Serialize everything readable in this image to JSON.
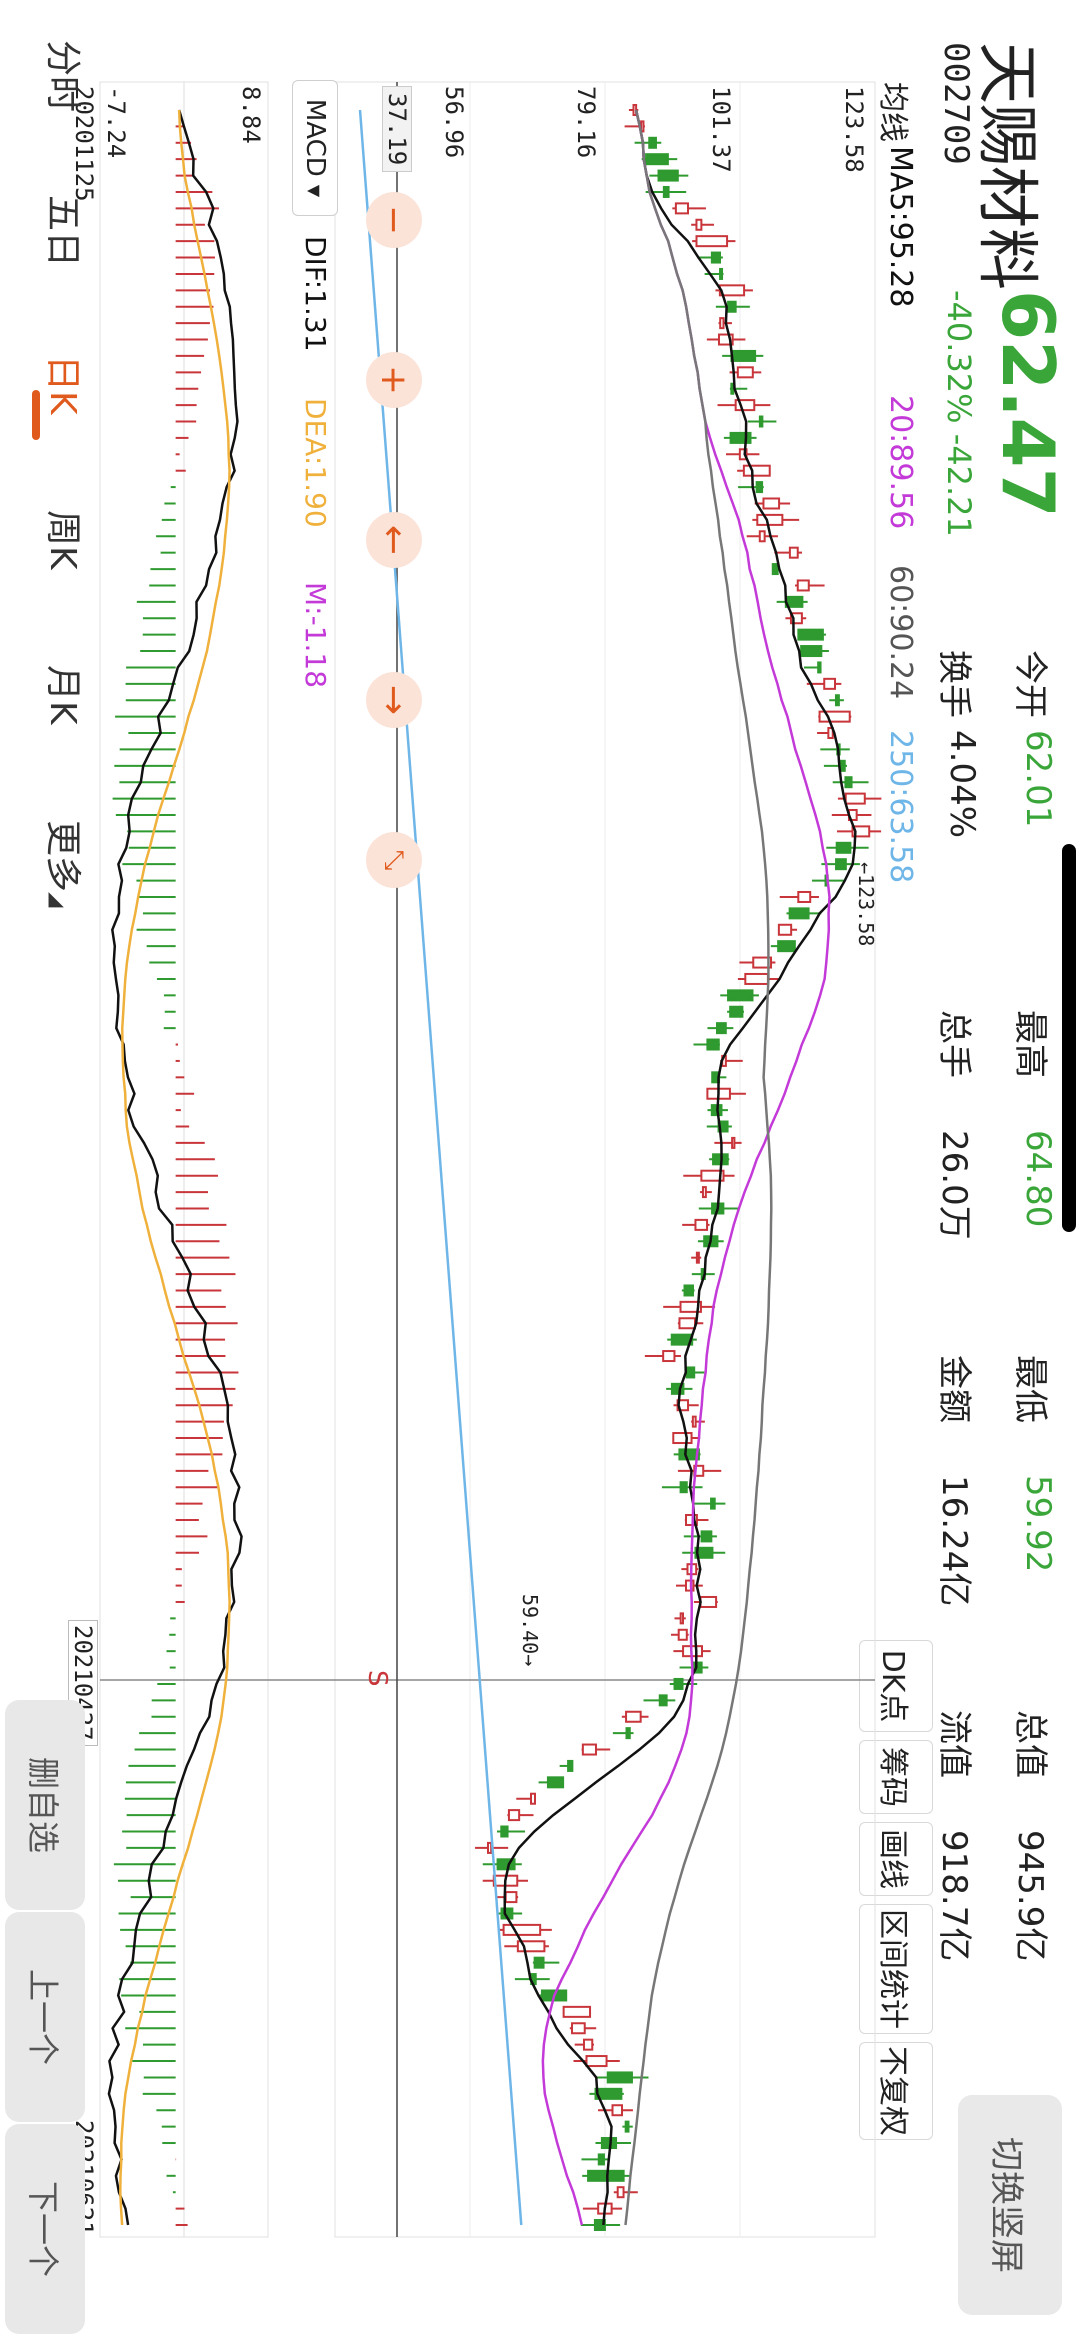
{
  "stock": {
    "name": "天赐材料",
    "code": "002709",
    "price": "62.47",
    "change_pct": "-40.32%",
    "change_amt": "-42.21"
  },
  "stats": {
    "open_label": "今开",
    "open": "62.01",
    "high_label": "最高",
    "high": "64.80",
    "low_label": "最低",
    "low": "59.92",
    "cap_label": "总值",
    "cap": "945.9亿",
    "turnover_label": "换手",
    "turnover": "4.04%",
    "volume_label": "总手",
    "volume": "26.0万",
    "amount_label": "金额",
    "amount": "16.24亿",
    "float_label": "流值",
    "float_cap": "918.7亿"
  },
  "header_button": "切换竖屏",
  "toolbar": [
    "DK点",
    "筹码",
    "画线",
    "区间统计",
    "不复权"
  ],
  "ma_line": {
    "label": "均线",
    "ma5": "MA5:95.28",
    "ma20": "20:89.56",
    "ma60": "60:90.24",
    "ma250": "250:63.58"
  },
  "main_chart": {
    "y_top": "123.58",
    "y_mid1": "101.37",
    "y_mid2": "79.16",
    "y_low": "56.96",
    "y_bottom": "37.19",
    "max_marker": "←123.58",
    "min_marker": "59.40→",
    "signal": "S",
    "crosshair_date": "20210427"
  },
  "indicator": {
    "name": "MACD",
    "dif": "DIF:1.31",
    "dea": "DEA:1.90",
    "m": "M:-1.18",
    "y_top": "8.84",
    "y_bottom": "-7.24"
  },
  "dates": {
    "start": "20201125",
    "end": "20210621"
  },
  "period_tabs": [
    "分时",
    "五日",
    "日K",
    "周K",
    "月K",
    "更多"
  ],
  "active_tab": "日K",
  "bottom_buttons": [
    "删自选",
    "上一个",
    "下一个"
  ],
  "controls": [
    "zoom-out",
    "zoom-in",
    "move-left",
    "move-right",
    "fit-screen"
  ],
  "colors": {
    "up": "#c8353a",
    "down": "#2f9a2f",
    "ma5": "#111111",
    "ma20": "#c33ad8",
    "ma60": "#777777",
    "ma250": "#6fb6e8",
    "dea": "#f0b13c",
    "accent": "#e05a1e"
  }
}
